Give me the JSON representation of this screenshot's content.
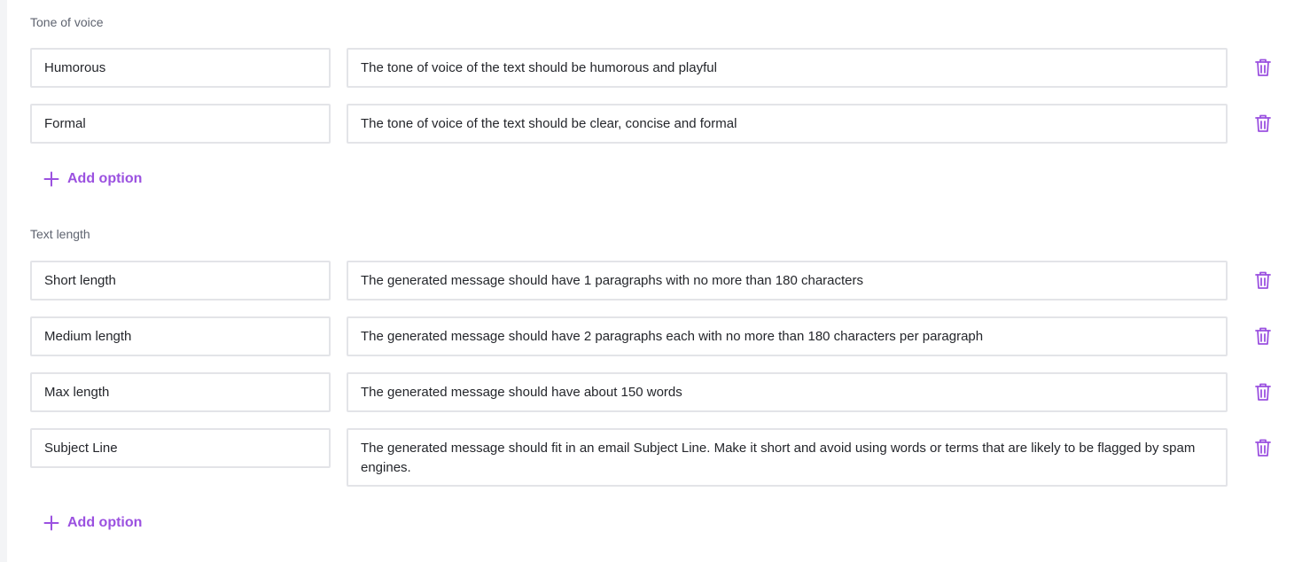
{
  "accent_color": "#9b51e0",
  "sections": [
    {
      "label": "Tone of voice",
      "options": [
        {
          "name": "Humorous",
          "description": "The tone of voice of the text should be humorous and playful",
          "delete_icon": "trash-icon"
        },
        {
          "name": "Formal",
          "description": "The tone of voice of the text should be clear, concise and formal",
          "delete_icon": "trash-icon"
        }
      ],
      "add_label": "Add option",
      "add_icon": "plus-icon"
    },
    {
      "label": "Text length",
      "options": [
        {
          "name": "Short length",
          "description": "The generated message should have 1 paragraphs with no more than 180 characters",
          "delete_icon": "trash-icon"
        },
        {
          "name": "Medium length",
          "description": "The generated message should have 2 paragraphs each with no more than 180 characters per paragraph",
          "delete_icon": "trash-icon"
        },
        {
          "name": "Max length",
          "description": "The generated message should have about 150 words",
          "delete_icon": "trash-icon"
        },
        {
          "name": "Subject Line",
          "description": "The generated message should fit in an email Subject Line. Make it short and avoid using words or terms that are likely to be flagged by spam engines.",
          "delete_icon": "trash-icon"
        }
      ],
      "add_label": "Add option",
      "add_icon": "plus-icon"
    }
  ]
}
